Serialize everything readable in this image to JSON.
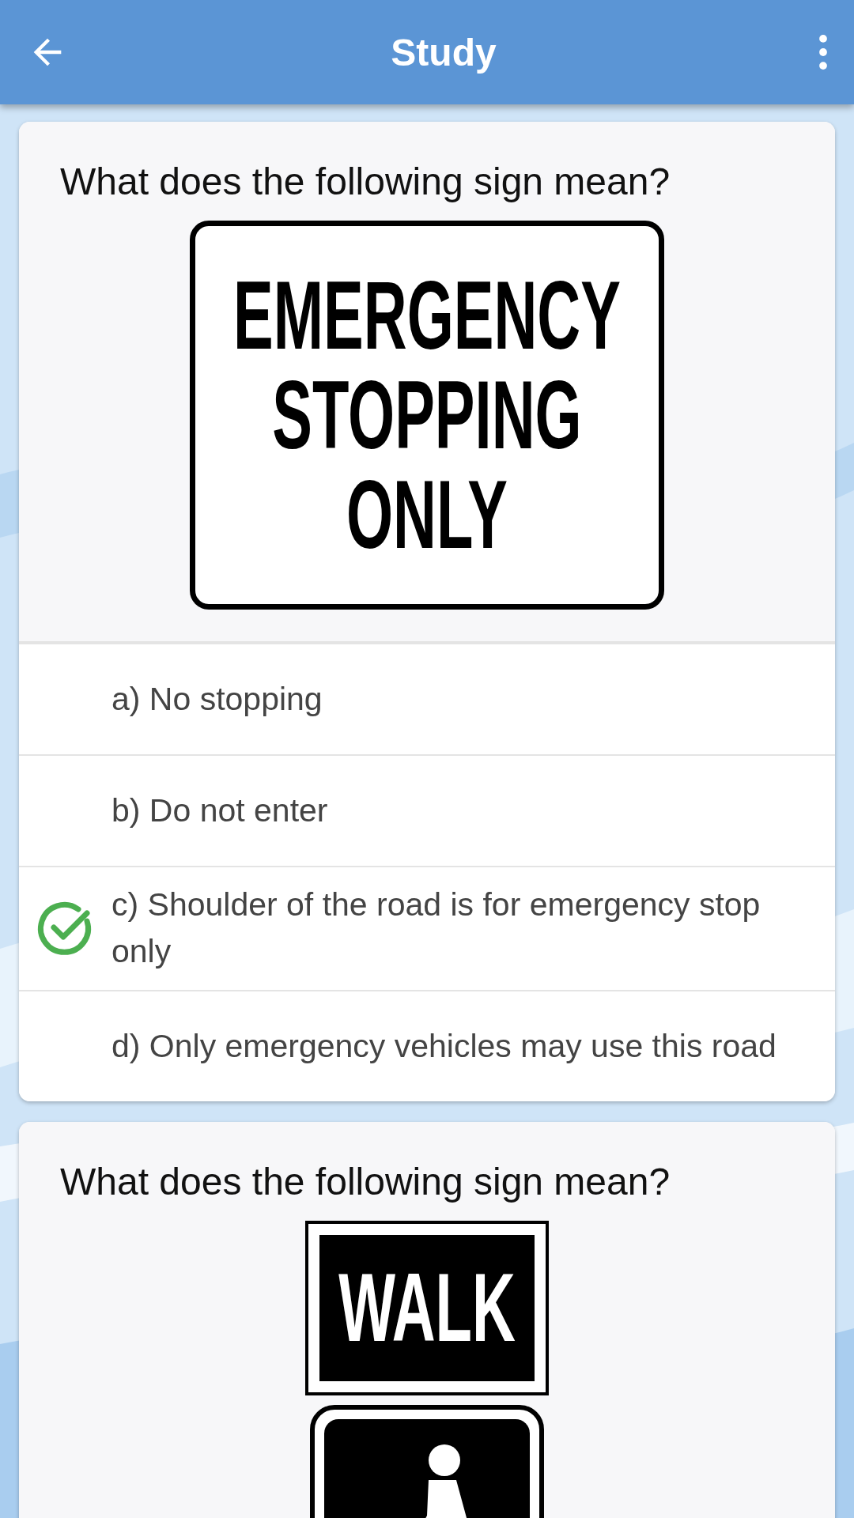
{
  "app_bar": {
    "title": "Study"
  },
  "questions": [
    {
      "prompt": "What does the following sign mean?",
      "signs": [
        {
          "kind": "plain",
          "lines": [
            "EMERGENCY",
            "STOPPING",
            "ONLY"
          ]
        }
      ],
      "answers": [
        {
          "label": "a) No stopping",
          "correct": false
        },
        {
          "label": "b) Do not enter",
          "correct": false
        },
        {
          "label": "c) Shoulder of the road is for emergency stop only",
          "correct": true
        },
        {
          "label": "d) Only emergency vehicles may use this road",
          "correct": false
        }
      ]
    },
    {
      "prompt": "What does the following sign mean?",
      "signs": [
        {
          "kind": "inverse",
          "lines": [
            "WALK"
          ]
        },
        {
          "kind": "pedestrian"
        }
      ]
    }
  ]
}
